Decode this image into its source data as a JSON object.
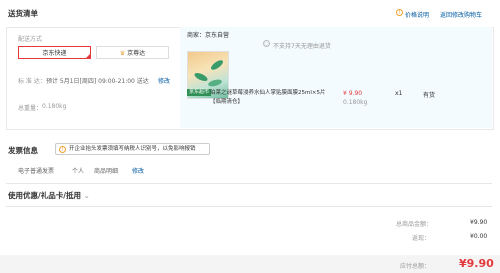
{
  "header": {
    "title": "送货清单",
    "price_note": "价格说明",
    "back_to_cart": "返回修改购物车"
  },
  "shipping": {
    "method_label": "配送方式",
    "options": [
      {
        "label": "京东快递",
        "selected": true
      },
      {
        "label": "京尊达",
        "selected": false
      }
    ],
    "schedule_label": "标 准 达：",
    "schedule_value": "预计 5月1日[周四] 09:00-21:00 送达",
    "schedule_edit": "修改",
    "weight_label": "总重量：",
    "weight_value": "0.180kg"
  },
  "store": {
    "seller_label": "商家：",
    "seller_name": "京东自营",
    "return_policy": "不支持7天无理由退货",
    "product": {
      "badge": "京东超市",
      "name": "珀莱之谜草莓浸养水仙人掌贴膜面膜25ml×5片【临期清仓】",
      "price": "¥ 9.90",
      "weight": "0.180kg",
      "quantity": "x1",
      "stock": "有货"
    }
  },
  "invoice": {
    "title": "发票信息",
    "hint": "开企业抬头发票须填写纳税人识别号，以免影响报销",
    "type": "电子普通发票",
    "receiver": "个人",
    "content": "商品明细",
    "edit": "修改"
  },
  "coupons": {
    "title": "使用优惠/礼品卡/抵用"
  },
  "summary": {
    "total_label": "总商品金额：",
    "total_value": "¥9.90",
    "rebate_label": "返现：",
    "rebate_value": "¥0.00",
    "payable_label": "应付总额：",
    "payable_value": "¥9.90"
  },
  "colors": {
    "accent_red": "#e4393c",
    "link_blue": "#005aa0",
    "panel_bg": "#f3fbfe",
    "badge_green": "#2f8f55"
  }
}
